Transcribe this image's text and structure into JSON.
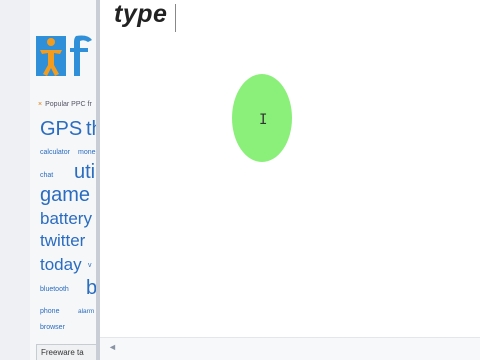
{
  "background_page": {
    "popular_heading": "Popular PPC fr",
    "tags": [
      {
        "text": "GPS",
        "size": "xl"
      },
      {
        "text": "th",
        "size": "xl"
      },
      {
        "text": "calculator",
        "size": "sm"
      },
      {
        "text": "mone",
        "size": "sm"
      },
      {
        "text": "chat",
        "size": "sm"
      },
      {
        "text": "uti",
        "size": "xl"
      },
      {
        "text": "game",
        "size": "xl"
      },
      {
        "text": "battery",
        "size": "lg"
      },
      {
        "text": "twitter",
        "size": "lg"
      },
      {
        "text": "today",
        "size": "lg"
      },
      {
        "text": "v",
        "size": "sm"
      },
      {
        "text": "bluetooth",
        "size": "sm"
      },
      {
        "text": "b",
        "size": "xl"
      },
      {
        "text": "phone",
        "size": "sm"
      },
      {
        "text": "alarm",
        "size": "xs"
      },
      {
        "text": "browser",
        "size": "sm"
      }
    ],
    "freeware_tab": "Freeware ta",
    "logo_icon": "logo-icon"
  },
  "canvas": {
    "title": "type",
    "cursor_icon": "text-cursor-icon",
    "circle_color": "#8af07a"
  },
  "bottom_strip": {
    "arrow_icon": "scroll-left-arrow-icon",
    "arrow_glyph": "◄"
  }
}
